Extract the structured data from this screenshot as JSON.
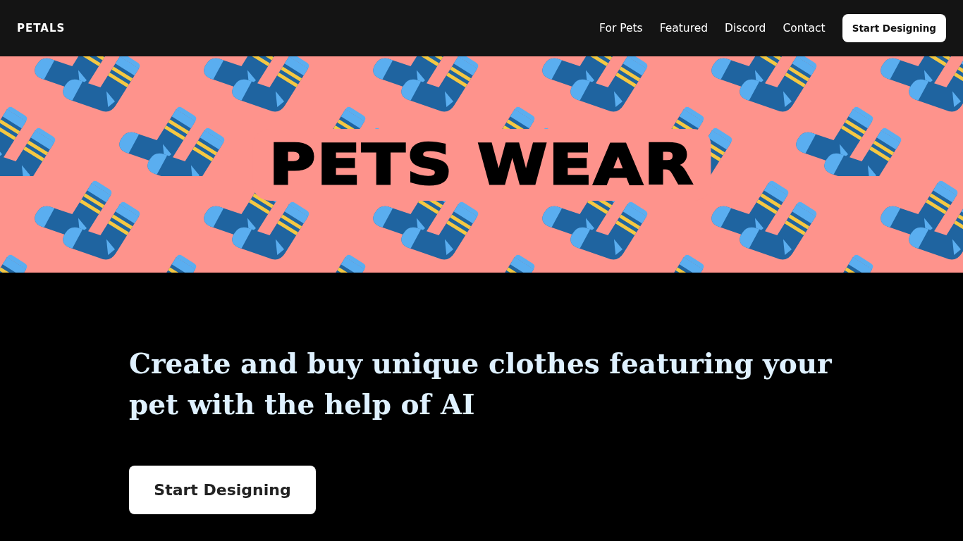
{
  "nav": {
    "brand": "PETALS",
    "links": [
      "For Pets",
      "Featured",
      "Discord",
      "Contact"
    ],
    "cta": "Start Designing"
  },
  "banner": {
    "title": "PETS WEAR"
  },
  "hero": {
    "headline": "Create and buy unique clothes featuring your pet with the help of AI",
    "button": "Start Designing"
  }
}
